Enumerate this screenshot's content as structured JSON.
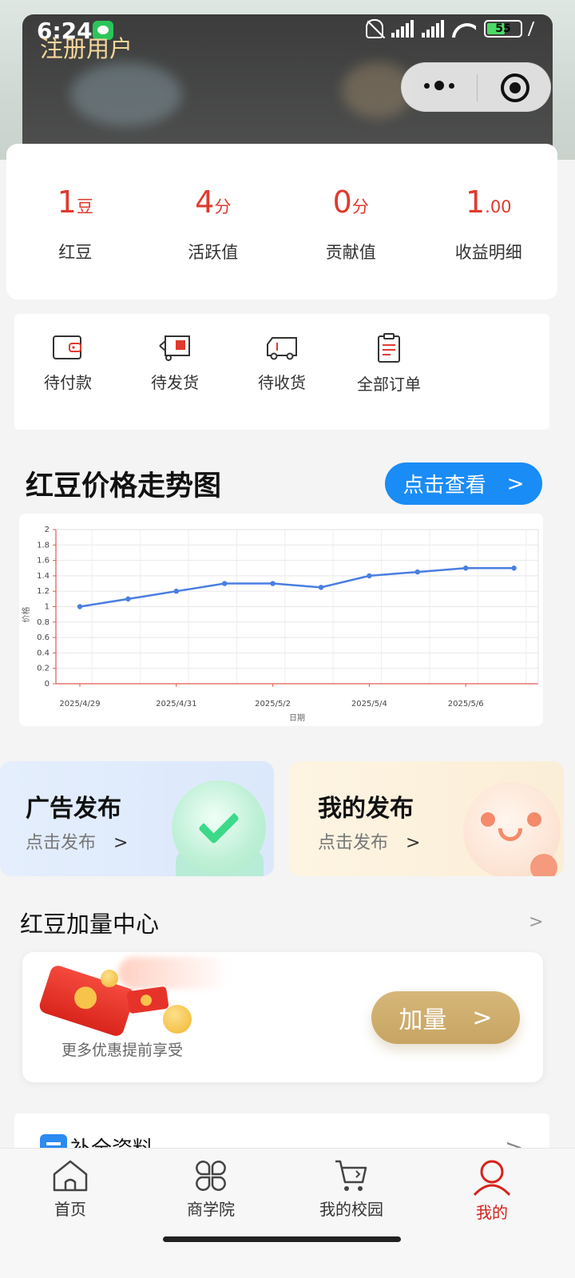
{
  "status_bar": {
    "time": "6:24",
    "battery": "55"
  },
  "header": {
    "user_name": "注册用户"
  },
  "stats": [
    {
      "value": "1",
      "unit": "豆",
      "label": "红豆"
    },
    {
      "value": "4",
      "unit": "分",
      "label": "活跃值"
    },
    {
      "value": "0",
      "unit": "分",
      "label": "贡献值"
    },
    {
      "value": "1",
      "unit": ".00",
      "label": "收益明细"
    }
  ],
  "orders": [
    {
      "label": "待付款",
      "icon": "wallet-icon"
    },
    {
      "label": "待发货",
      "icon": "delivery-box-icon"
    },
    {
      "label": "待收货",
      "icon": "truck-icon"
    },
    {
      "label": "全部订单",
      "icon": "clipboard-icon"
    }
  ],
  "trend": {
    "title": "红豆价格走势图",
    "button_label": "点击查看",
    "button_arrow": ">"
  },
  "chart_data": {
    "type": "line",
    "xlabel": "日期",
    "ylabel": "价格",
    "ylim": [
      0,
      2
    ],
    "yticks": [
      "0",
      "0.2",
      "0.4",
      "0.6",
      "0.8",
      "1",
      "1.2",
      "1.4",
      "1.6",
      "1.8",
      "2"
    ],
    "xtick_labels": [
      "2025/4/29",
      "2025/4/31",
      "2025/5/2",
      "2025/5/4",
      "2025/5/6"
    ],
    "values": [
      1.0,
      1.1,
      1.2,
      1.3,
      1.3,
      1.25,
      1.4,
      1.45,
      1.5,
      1.5
    ],
    "grid": true,
    "color": "#4a7ee0"
  },
  "promos": [
    {
      "title": "广告发布",
      "subtitle": "点击发布",
      "arrow": ">"
    },
    {
      "title": "我的发布",
      "subtitle": "点击发布",
      "arrow": ">"
    }
  ],
  "boost": {
    "title": "红豆加量中心",
    "more": ">",
    "subtitle": "更多优惠提前享受",
    "button_label": "加量",
    "button_arrow": ">"
  },
  "info": {
    "label": "补全资料",
    "arrow": ">"
  },
  "tabs": [
    {
      "label": "首页",
      "icon": "home-icon"
    },
    {
      "label": "商学院",
      "icon": "grid-icon"
    },
    {
      "label": "我的校园",
      "icon": "cart-icon"
    },
    {
      "label": "我的",
      "icon": "person-icon",
      "active": true
    }
  ],
  "colors": {
    "accent_red": "#e03a2f",
    "button_blue": "#1a8cf5",
    "gold": "#c9a668",
    "active_tab": "#d6221b"
  }
}
